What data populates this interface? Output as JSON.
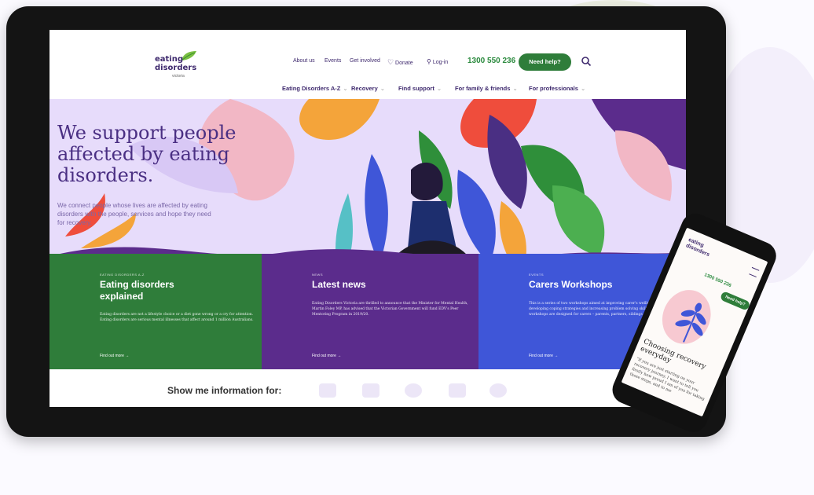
{
  "header": {
    "logo_line1": "eating",
    "logo_line2": "disorders",
    "logo_sub": "victoria",
    "top_links": [
      "About us",
      "Events",
      "Get involved",
      "Donate",
      "Log-in"
    ],
    "phone": "1300 550 236",
    "need_help": "Need help?"
  },
  "main_nav": [
    "Eating Disorders A-Z",
    "Recovery",
    "Find support",
    "For family & friends",
    "For professionals"
  ],
  "hero": {
    "title": "We support people affected by eating disorders.",
    "subtitle": "We connect people whose lives are affected by eating disorders with the people, services and hope they need for recovery."
  },
  "cards": [
    {
      "eyebrow": "EATING DISORDERS A-Z",
      "title": "Eating disorders explained",
      "body": "Eating disorders are not a lifestyle choice or a diet gone wrong or a cry for attention. Eating disorders are serious mental illnesses that affect around 1 million Australians.",
      "link": "Find out more",
      "color": "#2f7d3a"
    },
    {
      "eyebrow": "NEWS",
      "title": "Latest news",
      "body": "Eating Disorders Victoria are thrilled to announce that the Minister for Mental Health, Martin Foley MP, has advised that the Victorian Government will fund EDV's Peer Mentoring Program in 2019/20.",
      "link": "Find out more",
      "color": "#5b2c8c"
    },
    {
      "eyebrow": "EVENTS",
      "title": "Carers Workshops",
      "body": "This is a series of two workshops aimed at improving carer's wellbeing, developing coping strategies and increasing problem solving skills. The workshops are designed for carers – parents, partners, siblings or friends.",
      "link": "Find out more",
      "color": "#3f56d8"
    }
  ],
  "bottom": {
    "show_me": "Show me information for:"
  },
  "phone": {
    "logo_line1": "eating",
    "logo_line2": "disorders",
    "number": "1300 550 236",
    "need_help": "Need help?",
    "title": "Choosing recovery everyday",
    "body": "“If you are just starting on your recovery journey, I want to tell you firstly how proud I am of you for taking those steps, and to me"
  },
  "colors": {
    "brand_purple": "#3f2a6e",
    "brand_green": "#2f7d3a",
    "hero_bg": "#e7dcfb"
  }
}
